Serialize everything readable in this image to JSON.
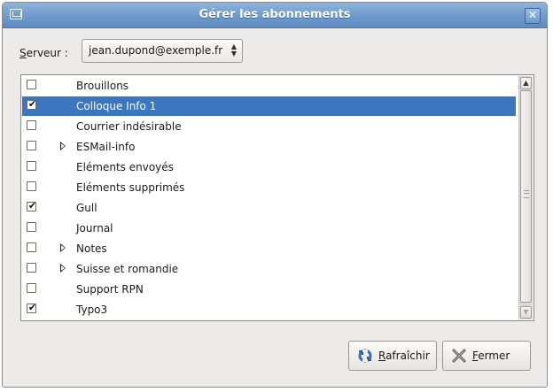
{
  "window": {
    "title": "Gérer les abonnements",
    "close_symbol": "✕"
  },
  "server": {
    "label_first": "S",
    "label_rest": "erveur :",
    "value": "jean.dupond@exemple.fr"
  },
  "folders": [
    {
      "name": "Brouillons",
      "checked": false,
      "expandable": false,
      "selected": false
    },
    {
      "name": "Colloque Info 1",
      "checked": true,
      "expandable": false,
      "selected": true
    },
    {
      "name": "Courrier indésirable",
      "checked": false,
      "expandable": false,
      "selected": false
    },
    {
      "name": "ESMail-info",
      "checked": false,
      "expandable": true,
      "selected": false
    },
    {
      "name": "Eléments envoyés",
      "checked": false,
      "expandable": false,
      "selected": false
    },
    {
      "name": "Eléments supprimés",
      "checked": false,
      "expandable": false,
      "selected": false
    },
    {
      "name": "Gull",
      "checked": true,
      "expandable": false,
      "selected": false
    },
    {
      "name": "Journal",
      "checked": false,
      "expandable": false,
      "selected": false
    },
    {
      "name": "Notes",
      "checked": false,
      "expandable": true,
      "selected": false
    },
    {
      "name": "Suisse et romandie",
      "checked": false,
      "expandable": true,
      "selected": false
    },
    {
      "name": "Support RPN",
      "checked": false,
      "expandable": false,
      "selected": false
    },
    {
      "name": "Typo3",
      "checked": true,
      "expandable": false,
      "selected": false
    }
  ],
  "buttons": {
    "refresh_first": "R",
    "refresh_rest": "afraîchir",
    "close_first": "F",
    "close_rest": "ermer"
  },
  "icons": {
    "window_menu": "window-menu-icon",
    "refresh": "refresh-icon",
    "close": "close-x-icon",
    "expander": "triangle-right-icon",
    "check": "checkmark-icon"
  },
  "colors": {
    "titlebar": "#6f9acb",
    "selection": "#3d76c0",
    "window_bg": "#edebe9"
  }
}
